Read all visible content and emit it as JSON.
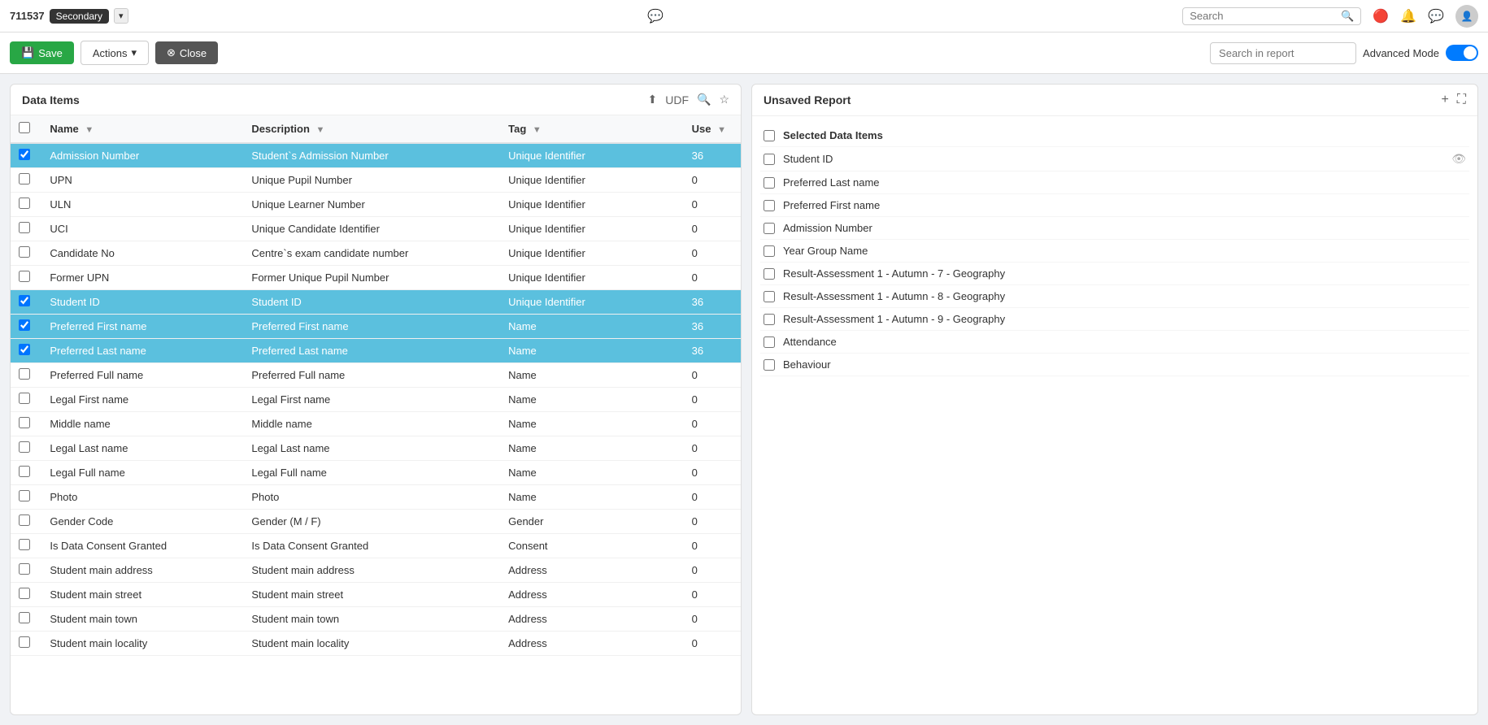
{
  "topNav": {
    "schoolId": "711537",
    "schoolBadge": "Secondary",
    "searchPlaceholder": "Search",
    "icons": [
      "message-icon",
      "alert-icon",
      "chat-icon",
      "avatar-icon"
    ]
  },
  "toolbar": {
    "saveLabel": "Save",
    "actionsLabel": "Actions",
    "closeLabel": "Close",
    "searchReportPlaceholder": "Search in report",
    "advancedModeLabel": "Advanced Mode"
  },
  "leftPanel": {
    "title": "Data Items",
    "udfLabel": "UDF",
    "columns": [
      {
        "key": "name",
        "label": "Name"
      },
      {
        "key": "description",
        "label": "Description"
      },
      {
        "key": "tag",
        "label": "Tag"
      },
      {
        "key": "use",
        "label": "Use"
      }
    ],
    "rows": [
      {
        "id": 1,
        "name": "Admission Number",
        "description": "Student`s Admission Number",
        "tag": "Unique Identifier",
        "use": "36",
        "selected": true
      },
      {
        "id": 2,
        "name": "UPN",
        "description": "Unique Pupil Number",
        "tag": "Unique Identifier",
        "use": "0",
        "selected": false
      },
      {
        "id": 3,
        "name": "ULN",
        "description": "Unique Learner Number",
        "tag": "Unique Identifier",
        "use": "0",
        "selected": false
      },
      {
        "id": 4,
        "name": "UCI",
        "description": "Unique Candidate Identifier",
        "tag": "Unique Identifier",
        "use": "0",
        "selected": false
      },
      {
        "id": 5,
        "name": "Candidate No",
        "description": "Centre`s exam candidate number",
        "tag": "Unique Identifier",
        "use": "0",
        "selected": false
      },
      {
        "id": 6,
        "name": "Former UPN",
        "description": "Former Unique Pupil Number",
        "tag": "Unique Identifier",
        "use": "0",
        "selected": false
      },
      {
        "id": 7,
        "name": "Student ID",
        "description": "Student ID",
        "tag": "Unique Identifier",
        "use": "36",
        "selected": true
      },
      {
        "id": 8,
        "name": "Preferred First name",
        "description": "Preferred First name",
        "tag": "Name",
        "use": "36",
        "selected": true
      },
      {
        "id": 9,
        "name": "Preferred Last name",
        "description": "Preferred Last name",
        "tag": "Name",
        "use": "36",
        "selected": true
      },
      {
        "id": 10,
        "name": "Preferred Full name",
        "description": "Preferred Full name",
        "tag": "Name",
        "use": "0",
        "selected": false
      },
      {
        "id": 11,
        "name": "Legal First name",
        "description": "Legal First name",
        "tag": "Name",
        "use": "0",
        "selected": false
      },
      {
        "id": 12,
        "name": "Middle name",
        "description": "Middle name",
        "tag": "Name",
        "use": "0",
        "selected": false
      },
      {
        "id": 13,
        "name": "Legal Last name",
        "description": "Legal Last name",
        "tag": "Name",
        "use": "0",
        "selected": false
      },
      {
        "id": 14,
        "name": "Legal Full name",
        "description": "Legal Full name",
        "tag": "Name",
        "use": "0",
        "selected": false
      },
      {
        "id": 15,
        "name": "Photo",
        "description": "Photo",
        "tag": "Name",
        "use": "0",
        "selected": false
      },
      {
        "id": 16,
        "name": "Gender Code",
        "description": "Gender (M / F)",
        "tag": "Gender",
        "use": "0",
        "selected": false
      },
      {
        "id": 17,
        "name": "Is Data Consent Granted",
        "description": "Is Data Consent Granted",
        "tag": "Consent",
        "use": "0",
        "selected": false
      },
      {
        "id": 18,
        "name": "Student main address",
        "description": "Student main address",
        "tag": "Address",
        "use": "0",
        "selected": false
      },
      {
        "id": 19,
        "name": "Student main street",
        "description": "Student main street",
        "tag": "Address",
        "use": "0",
        "selected": false
      },
      {
        "id": 20,
        "name": "Student main town",
        "description": "Student main town",
        "tag": "Address",
        "use": "0",
        "selected": false
      },
      {
        "id": 21,
        "name": "Student main locality",
        "description": "Student main locality",
        "tag": "Address",
        "use": "0",
        "selected": false
      }
    ]
  },
  "rightPanel": {
    "title": "Unsaved Report",
    "selectedItems": [
      {
        "id": 1,
        "label": "Selected Data Items",
        "hidden": false,
        "isHeader": true
      },
      {
        "id": 2,
        "label": "Student ID",
        "hidden": true,
        "isHeader": false
      },
      {
        "id": 3,
        "label": "Preferred Last name",
        "hidden": false,
        "isHeader": false
      },
      {
        "id": 4,
        "label": "Preferred First name",
        "hidden": false,
        "isHeader": false
      },
      {
        "id": 5,
        "label": "Admission Number",
        "hidden": false,
        "isHeader": false
      },
      {
        "id": 6,
        "label": "Year Group Name",
        "hidden": false,
        "isHeader": false
      },
      {
        "id": 7,
        "label": "Result-Assessment 1 - Autumn - 7 - Geography",
        "hidden": false,
        "isHeader": false
      },
      {
        "id": 8,
        "label": "Result-Assessment 1 - Autumn - 8 - Geography",
        "hidden": false,
        "isHeader": false
      },
      {
        "id": 9,
        "label": "Result-Assessment 1 - Autumn - 9 - Geography",
        "hidden": false,
        "isHeader": false
      },
      {
        "id": 10,
        "label": "Attendance",
        "hidden": false,
        "isHeader": false
      },
      {
        "id": 11,
        "label": "Behaviour",
        "hidden": false,
        "isHeader": false
      }
    ]
  }
}
